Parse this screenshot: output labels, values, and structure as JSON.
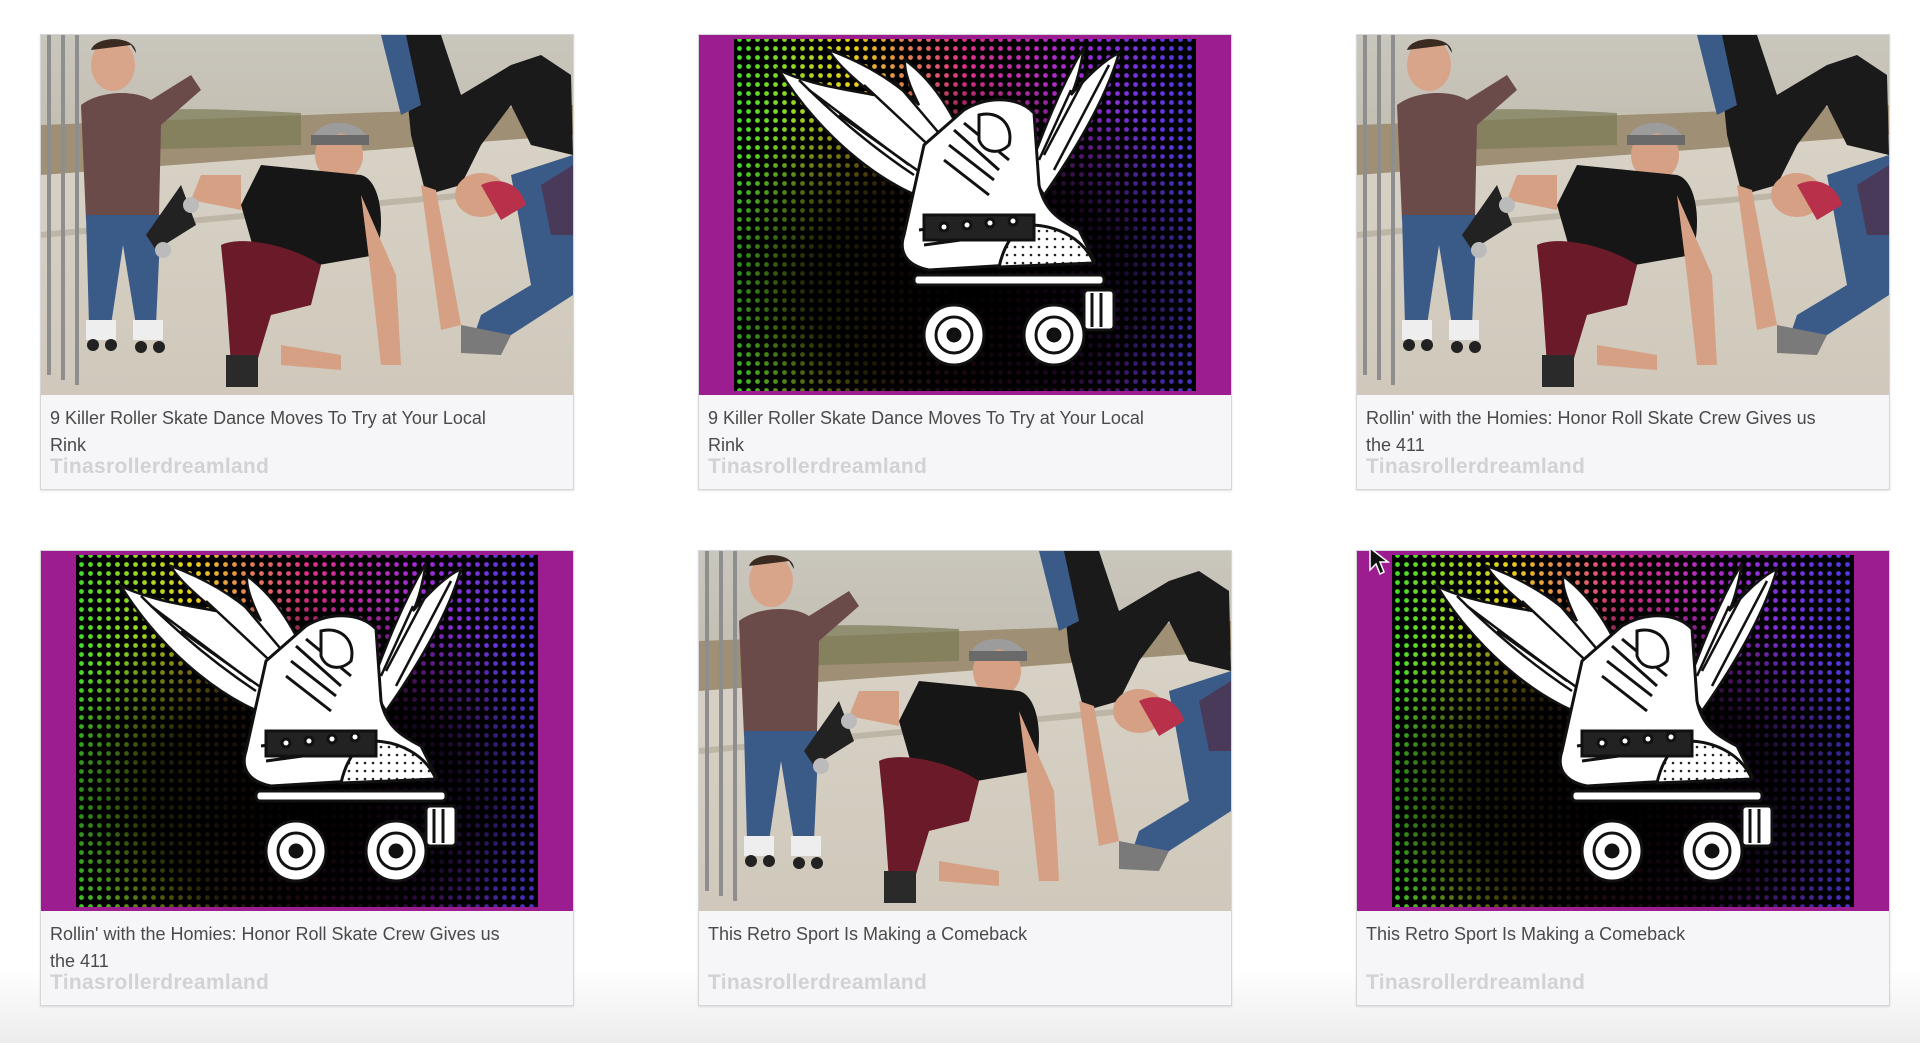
{
  "cards": [
    {
      "image": "skaters-photo",
      "title": "9 Killer Roller Skate Dance Moves To Try at Your Local Rink",
      "source": "Tinasrollerdreamland"
    },
    {
      "image": "winged-skate-logo",
      "title": "9 Killer Roller Skate Dance Moves To Try at Your Local Rink",
      "source": "Tinasrollerdreamland"
    },
    {
      "image": "skaters-photo",
      "title": "Rollin' with the Homies: Honor Roll Skate Crew Gives us the 411",
      "source": "Tinasrollerdreamland"
    },
    {
      "image": "winged-skate-logo",
      "title": "Rollin' with the Homies: Honor Roll Skate Crew Gives us the 411",
      "source": "Tinasrollerdreamland"
    },
    {
      "image": "skaters-photo",
      "title": "This Retro Sport Is Making a Comeback",
      "source": "Tinasrollerdreamland"
    },
    {
      "image": "winged-skate-logo",
      "title": "This Retro Sport Is Making a Comeback",
      "source": "Tinasrollerdreamland"
    }
  ],
  "colors": {
    "logo_frame": "#9b1d8f",
    "title_text": "#4a4a4a",
    "source_text": "#d2d2d6",
    "card_bg": "#f6f6f8"
  }
}
